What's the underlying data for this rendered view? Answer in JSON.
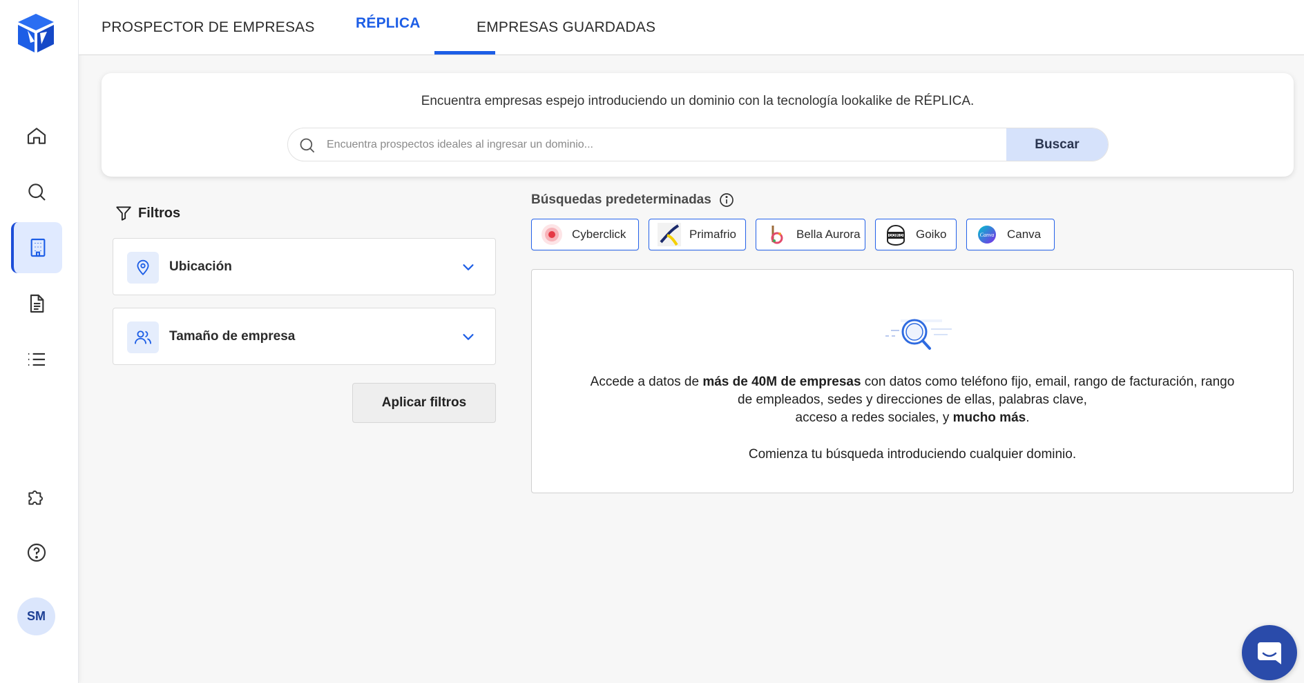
{
  "user": {
    "initials": "SM"
  },
  "tabs": [
    {
      "label": "PROSPECTOR DE EMPRESAS",
      "active": false
    },
    {
      "label": "RÉPLICA",
      "active": true
    },
    {
      "label": "EMPRESAS GUARDADAS",
      "active": false
    }
  ],
  "search": {
    "caption": "Encuentra empresas espejo introduciendo un dominio con la tecnología lookalike de RÉPLICA.",
    "placeholder": "Encuentra prospectos ideales al ingresar un dominio...",
    "button_label": "Buscar"
  },
  "filters": {
    "title": "Filtros",
    "items": [
      {
        "label": "Ubicación",
        "icon": "location-pin-icon"
      },
      {
        "label": "Tamaño de empresa",
        "icon": "users-icon"
      }
    ],
    "apply_label": "Aplicar filtros"
  },
  "presets": {
    "title": "Búsquedas predeterminadas",
    "chips": [
      {
        "label": "Cyberclick"
      },
      {
        "label": "Primafrio"
      },
      {
        "label": "Bella Aurora"
      },
      {
        "label": "Goiko"
      },
      {
        "label": "Canva"
      }
    ]
  },
  "info": {
    "line1_pre": "Accede a datos de ",
    "line1_bold": "más de 40M de empresas",
    "line1_post": " con datos como teléfono fijo, email, rango de facturación, rango",
    "line2": "de empleados, sedes y direcciones  de ellas, palabras clave,",
    "line3_pre": "acceso a redes sociales, y ",
    "line3_bold": "mucho más",
    "line3_post": ".",
    "cta": "Comienza tu búsqueda introduciendo cualquier dominio."
  },
  "logo_texts": {
    "goiko": "GOIKO",
    "canva": "Canva"
  },
  "colors": {
    "accent": "#1d5ee6",
    "active_nav_bg": "#e0eaff",
    "search_button_bg": "#d6e2fb",
    "chat_bubble": "#2a4baa"
  }
}
